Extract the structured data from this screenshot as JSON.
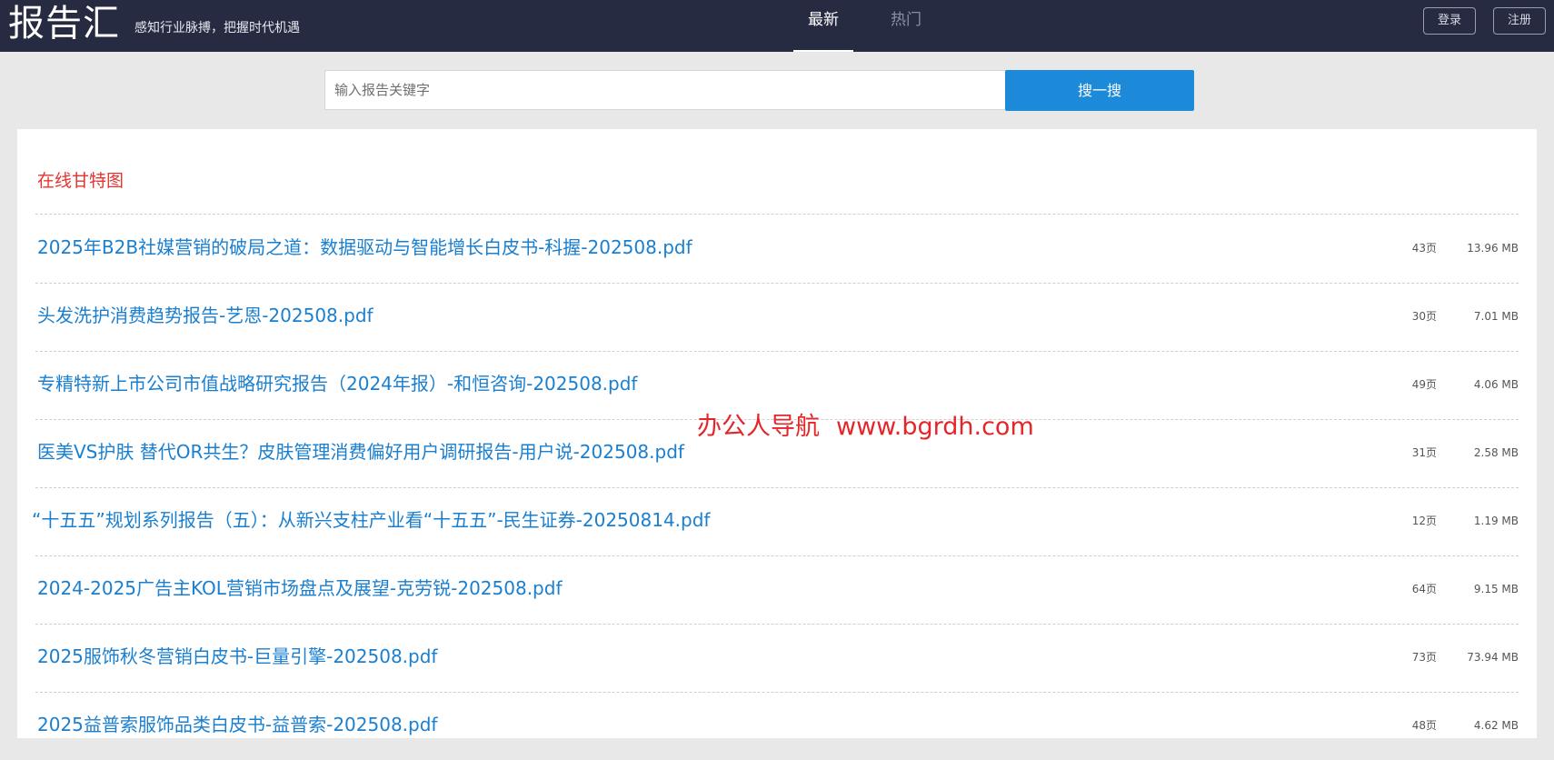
{
  "header": {
    "logo": "报告汇",
    "slogan": "感知行业脉搏，把握时代机遇",
    "tabs": [
      {
        "label": "最新",
        "active": true
      },
      {
        "label": "热门",
        "active": false
      }
    ],
    "login_label": "登录",
    "register_label": "注册"
  },
  "search": {
    "placeholder": "输入报告关键字",
    "value": "",
    "button_label": "搜一搜"
  },
  "section": {
    "title": "在线甘特图"
  },
  "reports": [
    {
      "title": "2025年B2B社媒营销的破局之道：数据驱动与智能增长白皮书-科握-202508.pdf",
      "pages": "43页",
      "size": "13.96 MB"
    },
    {
      "title": "头发洗护消费趋势报告-艺恩-202508.pdf",
      "pages": "30页",
      "size": "7.01 MB"
    },
    {
      "title": "专精特新上市公司市值战略研究报告（2024年报）-和恒咨询-202508.pdf",
      "pages": "49页",
      "size": "4.06 MB"
    },
    {
      "title": "医美VS护肤 替代OR共生？皮肤管理消费偏好用户调研报告-用户说-202508.pdf",
      "pages": "31页",
      "size": "2.58 MB"
    },
    {
      "title": "“十五五”规划系列报告（五）：从新兴支柱产业看“十五五”-民生证券-20250814.pdf",
      "pages": "12页",
      "size": "1.19 MB"
    },
    {
      "title": "2024-2025广告主KOL营销市场盘点及展望-克劳锐-202508.pdf",
      "pages": "64页",
      "size": "9.15 MB"
    },
    {
      "title": "2025服饰秋冬营销白皮书-巨量引擎-202508.pdf",
      "pages": "73页",
      "size": "73.94 MB"
    },
    {
      "title": "2025益普索服饰品类白皮书-益普索-202508.pdf",
      "pages": "48页",
      "size": "4.62 MB"
    }
  ],
  "watermark": {
    "name": "办公人导航",
    "url": "www.bgrdh.com"
  },
  "colors": {
    "navbar": "#272b42",
    "accent_blue": "#1c8ad8",
    "link_blue": "#1a7fcf",
    "section_red": "#e4342f"
  }
}
